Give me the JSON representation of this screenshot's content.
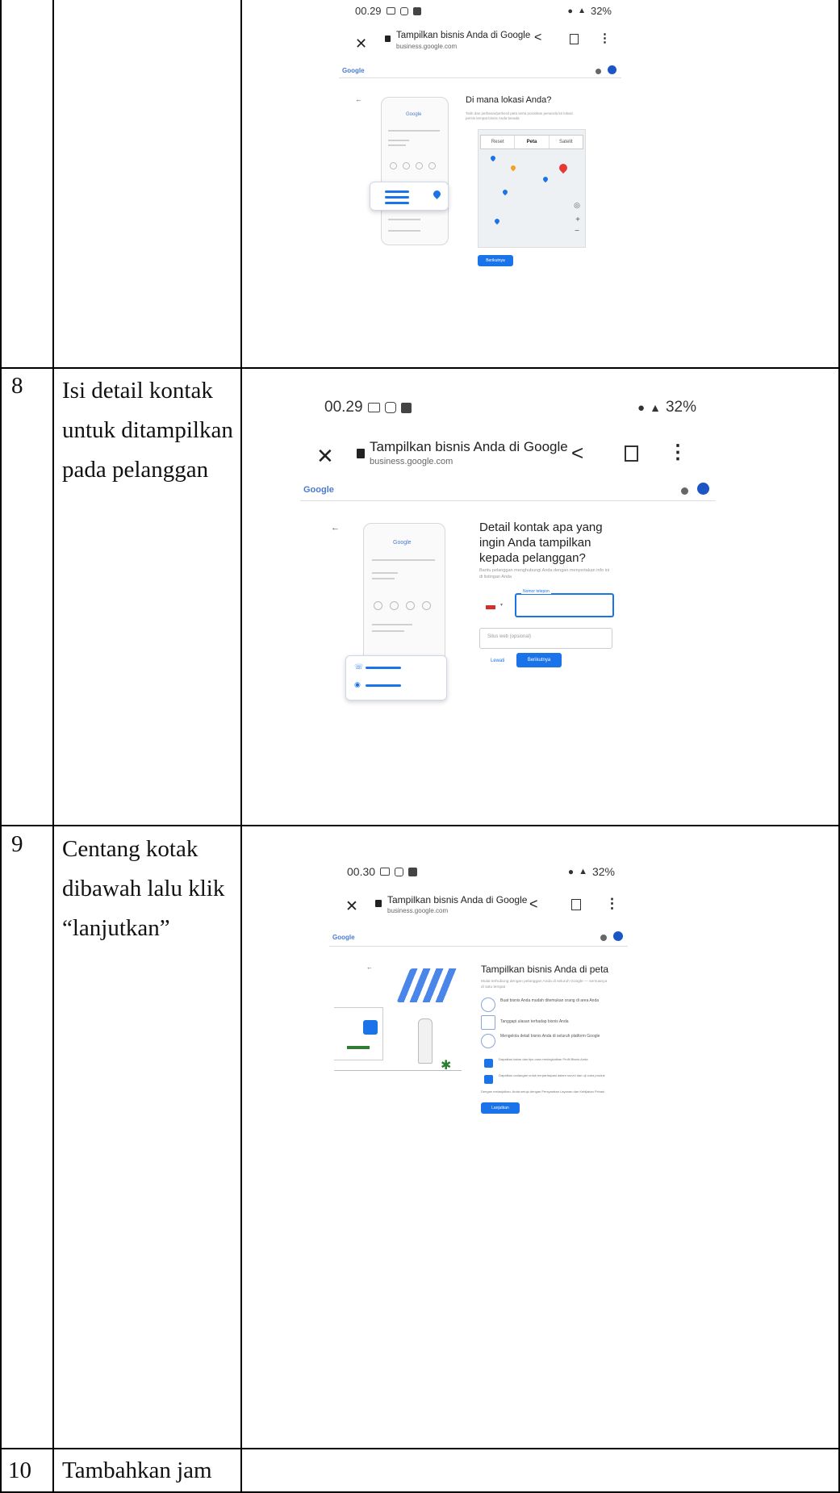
{
  "rows": [
    {
      "number": "",
      "instruction": []
    },
    {
      "number": "8",
      "instruction": [
        "Isi detail kontak",
        "untuk ditampilkan",
        "pada pelanggan"
      ]
    },
    {
      "number": "9",
      "instruction": [
        "Centang kotak",
        "dibawah lalu klik",
        "“lanjutkan”"
      ]
    },
    {
      "number": "10",
      "instruction": [
        "Tambahkan jam"
      ]
    }
  ],
  "screens": [
    {
      "time": "00.29",
      "battery": "32%",
      "browser_title": "Tampilkan bisnis Anda di Google",
      "browser_url": "business.google.com",
      "logo": "Google",
      "heading": "Di mana lokasi Anda?",
      "subtext": "Tarik dan perbesar/perkecil peta serta posisikan penanda ke lokasi persis tempat bisnis Anda berada",
      "map_tabs": [
        "Reset",
        "Peta",
        "Satelit"
      ],
      "button": "Berikutnya"
    },
    {
      "time": "00.29",
      "battery": "32%",
      "browser_title": "Tampilkan bisnis Anda di Google",
      "browser_url": "business.google.com",
      "logo": "Google",
      "heading": "Detail kontak apa yang ingin Anda tampilkan kepada pelanggan?",
      "subtext": "Bantu pelanggan menghubungi Anda dengan menyertakan info ini di listingan Anda",
      "phone_label": "Nomor telepon",
      "website_placeholder": "Situs web (opsional)",
      "skip": "Lewati",
      "button": "Berikutnya"
    },
    {
      "time": "00.30",
      "battery": "32%",
      "browser_title": "Tampilkan bisnis Anda di Google",
      "browser_url": "business.google.com",
      "logo": "Google",
      "heading": "Tampilkan bisnis Anda di peta",
      "subtext": "Mulai terhubung dengan pelanggan Anda di seluruh Google — semuanya di satu tempat",
      "features": [
        "Buat bisnis Anda mudah ditemukan orang di area Anda",
        "Tanggapi ulasan terhadap bisnis Anda",
        "Mengelola detail bisnis Anda di seluruh platform Google"
      ],
      "checks": [
        "Dapatkan kabar dan tips cara meningkatkan Profil Bisnis Anda",
        "Dapatkan undangan untuk berpartisipasi dalam survei dan uji coba produk"
      ],
      "terms": "Dengan melanjutkan, Anda setuju dengan Persyaratan Layanan dan Kebijakan Privasi",
      "button": "Lanjutkan"
    }
  ]
}
